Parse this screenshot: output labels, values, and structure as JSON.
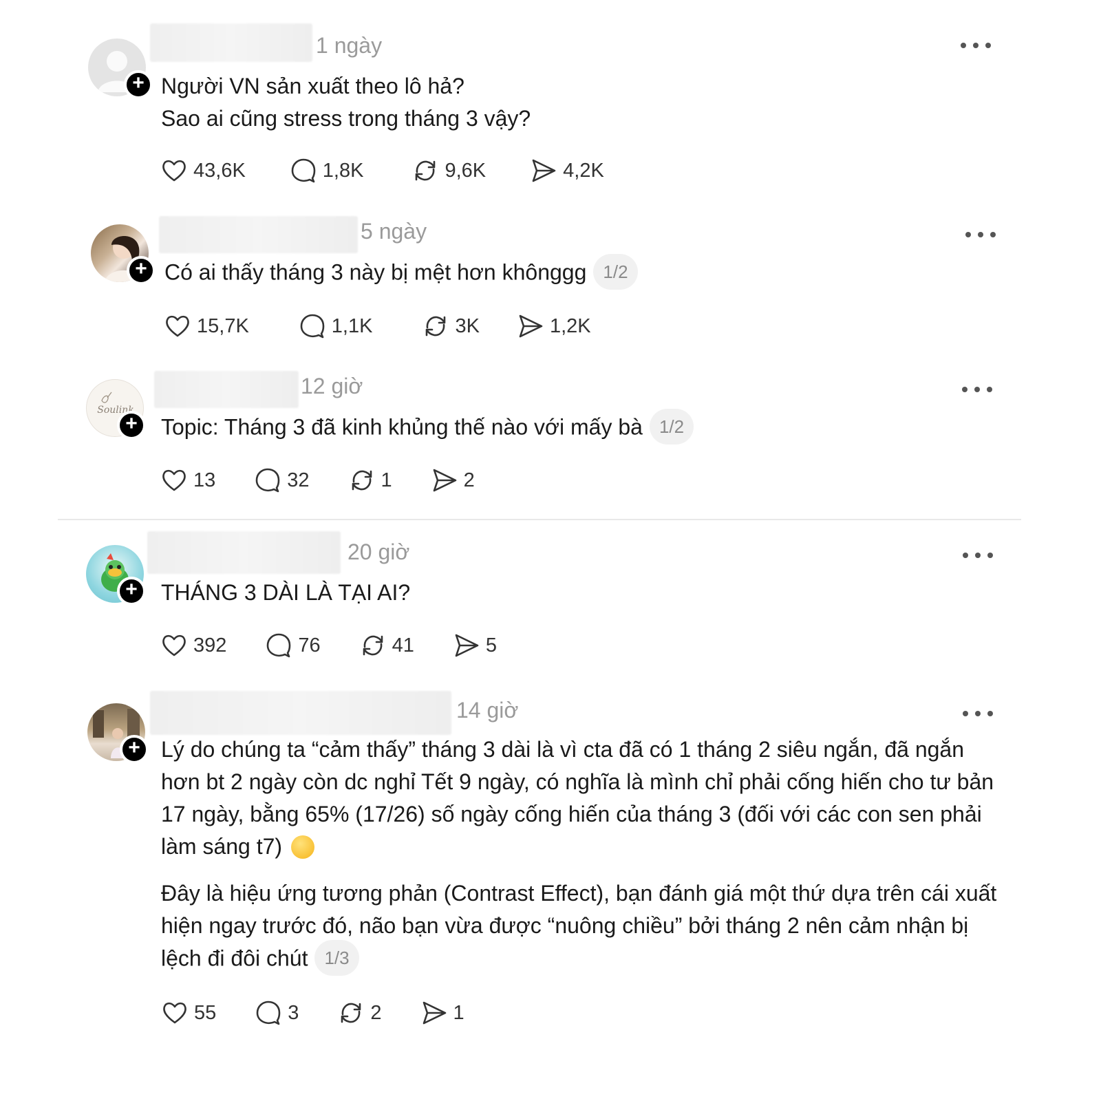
{
  "posts": [
    {
      "time": "1 ngày",
      "lines": [
        "Người VN sản xuất theo lô hả?",
        "Sao ai cũng stress trong tháng 3 vậy?"
      ],
      "pager": "",
      "likes": "43,6K",
      "comments": "1,8K",
      "reposts": "9,6K",
      "shares": "4,2K"
    },
    {
      "time": "5 ngày",
      "lines": [
        "Có ai thấy tháng 3 này bị mệt hơn khônggg"
      ],
      "pager": "1/2",
      "likes": "15,7K",
      "comments": "1,1K",
      "reposts": "3K",
      "shares": "1,2K"
    },
    {
      "time": "12 giờ",
      "lines": [
        "Topic: Tháng 3 đã kinh khủng thế nào với mấy bà"
      ],
      "pager": "1/2",
      "avatar_text": "Soulink",
      "likes": "13",
      "comments": "32",
      "reposts": "1",
      "shares": "2"
    },
    {
      "time": "20 giờ",
      "lines": [
        "THÁNG 3 DÀI LÀ TẠI AI?"
      ],
      "pager": "",
      "likes": "392",
      "comments": "76",
      "reposts": "41",
      "shares": "5"
    },
    {
      "time": "14 giờ",
      "para1": "Lý do chúng ta “cảm thấy” tháng 3 dài là vì cta đã có 1 tháng 2 siêu ngắn, đã ngắn hơn bt 2 ngày còn dc nghỉ Tết 9 ngày, có nghĩa là mình chỉ phải cống hiến cho tư bản 17 ngày, bằng 65% (17/26) số ngày cống hiến của tháng 3 (đối với các con sen phải làm sáng t7)",
      "para2": "Đây là hiệu ứng tương phản (Contrast Effect), bạn đánh giá một thứ dựa trên cái xuất hiện ngay trước đó, não bạn vừa được “nuông chiều” bởi tháng 2 nên cảm nhận bị lệch đi đôi chút",
      "pager": "1/3",
      "likes": "55",
      "comments": "3",
      "reposts": "2",
      "shares": "1"
    }
  ],
  "icons": {
    "like": "heart-icon",
    "comment": "comment-bubble-icon",
    "repost": "repost-icon",
    "share": "send-icon",
    "more": "more-dots-icon",
    "follow": "plus-icon"
  }
}
